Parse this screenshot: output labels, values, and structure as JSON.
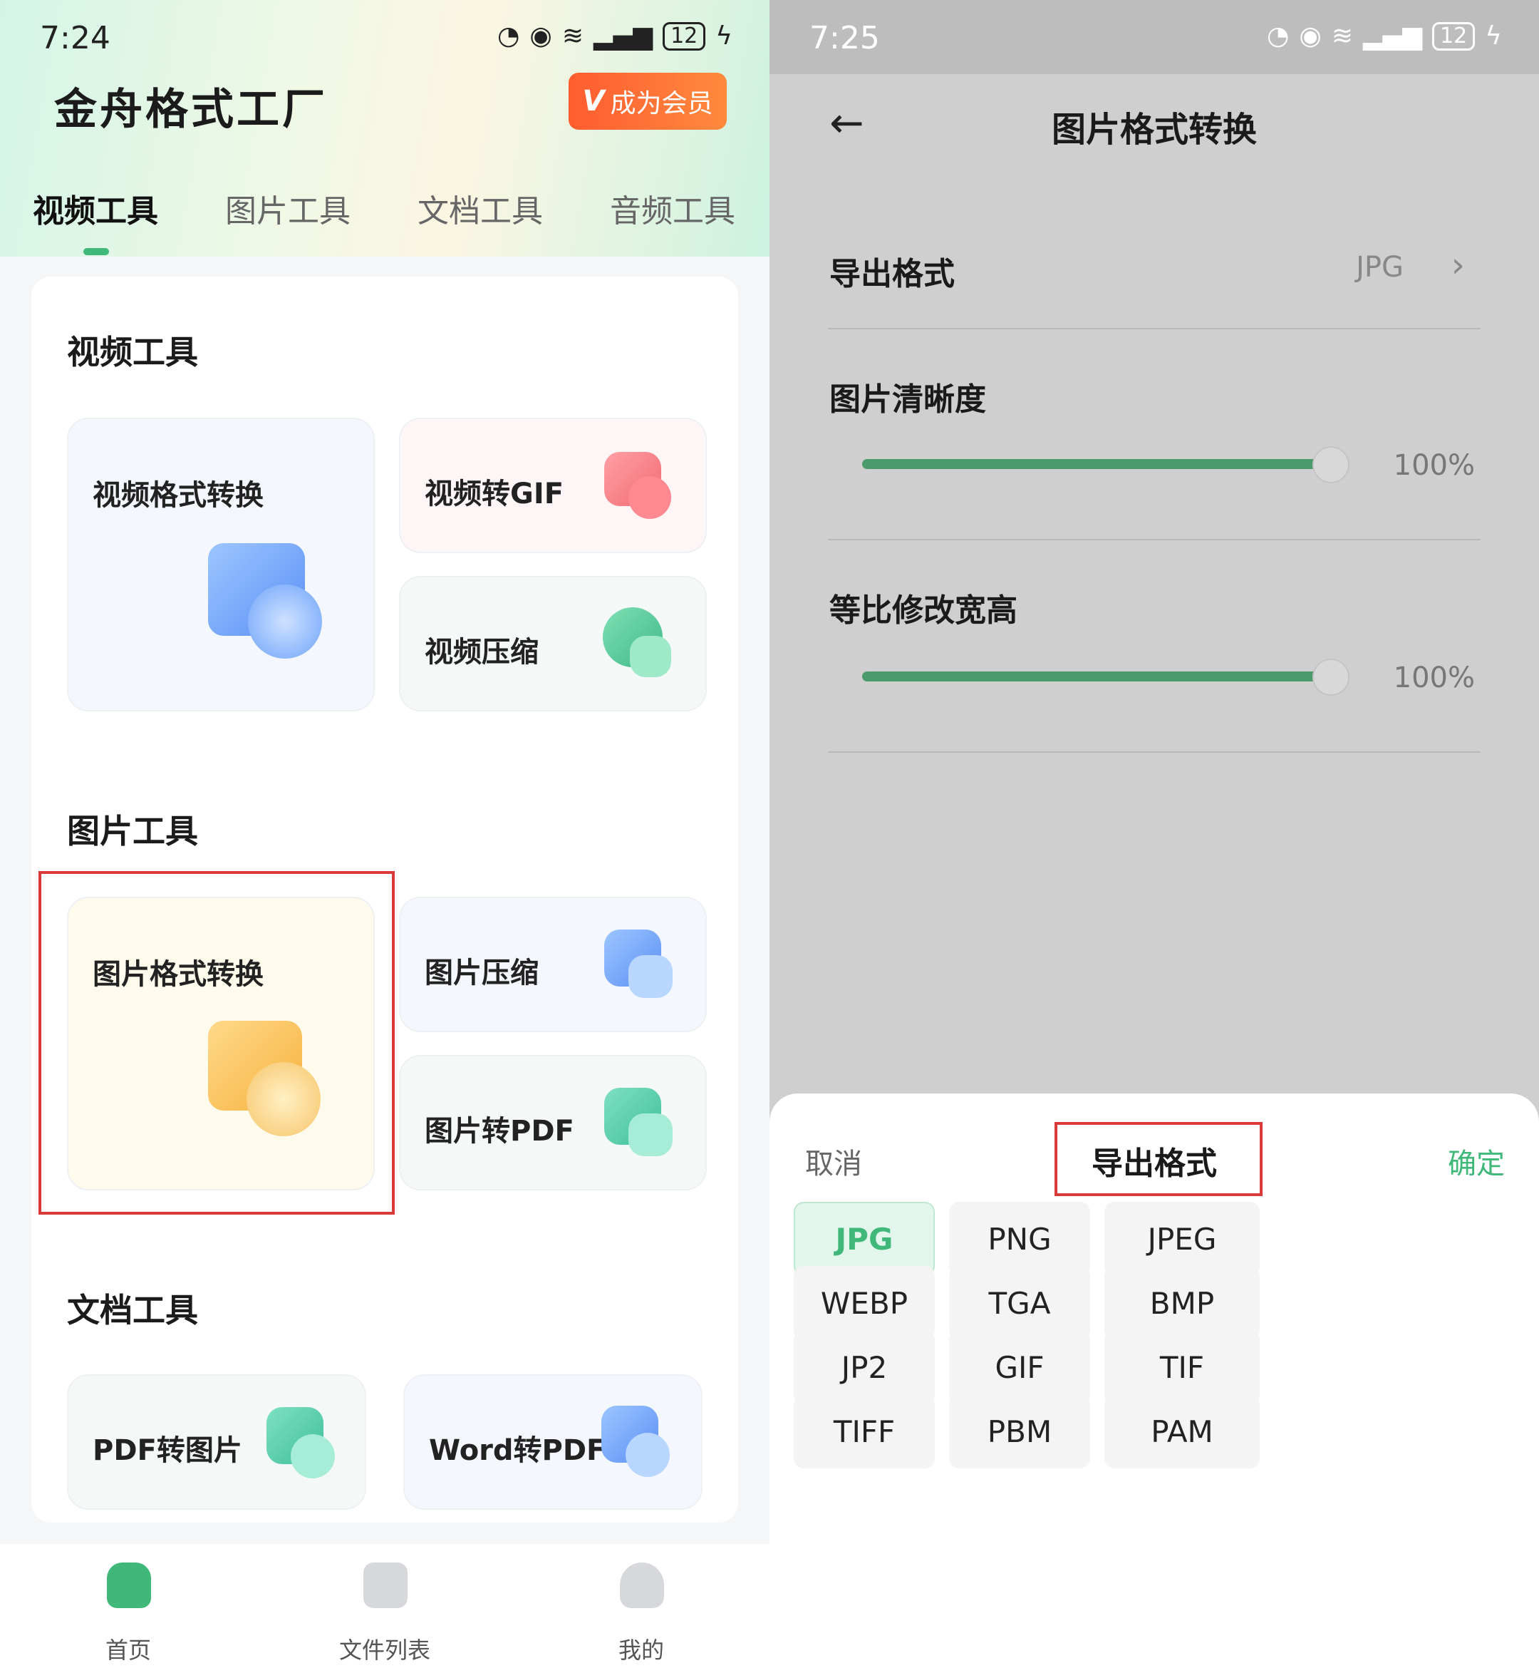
{
  "left": {
    "status": {
      "time": "7:24",
      "battery": "12"
    },
    "app_title": "金舟格式工厂",
    "vip_label": "成为会员",
    "tabs": [
      "视频工具",
      "图片工具",
      "文档工具",
      "音频工具"
    ],
    "sections": {
      "video": {
        "title": "视频工具",
        "tools": [
          "视频格式转换",
          "视频转GIF",
          "视频压缩"
        ]
      },
      "image": {
        "title": "图片工具",
        "tools": [
          "图片格式转换",
          "图片压缩",
          "图片转PDF"
        ]
      },
      "doc": {
        "title": "文档工具",
        "tools": [
          "PDF转图片",
          "Word转PDF"
        ]
      }
    },
    "nav": [
      "首页",
      "文件列表",
      "我的"
    ]
  },
  "right": {
    "status": {
      "time": "7:25",
      "battery": "12"
    },
    "title": "图片格式转换",
    "export_label": "导出格式",
    "export_value": "JPG",
    "clarity_label": "图片清晰度",
    "clarity_value": "100%",
    "clarity_level": 100,
    "ratio_label": "等比修改宽高",
    "ratio_value": "100%",
    "ratio_level": 100,
    "sheet": {
      "cancel": "取消",
      "title": "导出格式",
      "confirm": "确定",
      "formats": [
        "JPG",
        "PNG",
        "JPEG",
        "WEBP",
        "TGA",
        "BMP",
        "JP2",
        "GIF",
        "TIF",
        "TIFF",
        "PBM",
        "PAM"
      ],
      "selected": "JPG"
    }
  },
  "colors": {
    "accent": "#3fb87a",
    "vip": "#ff6a35",
    "highlight": "#d83a3a"
  }
}
